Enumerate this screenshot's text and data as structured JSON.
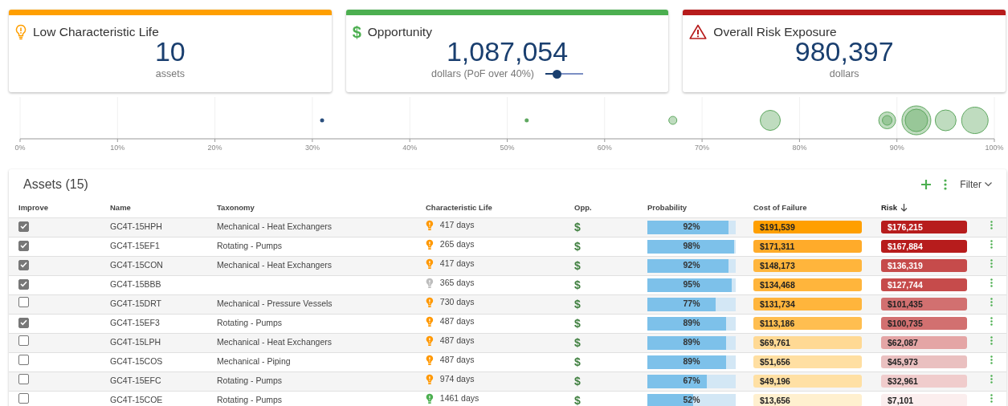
{
  "cards": [
    {
      "kind": "lightbulb",
      "color": "#ff9f00",
      "title": "Low Characteristic Life",
      "value": "10",
      "unit": "assets"
    },
    {
      "kind": "dollar",
      "color": "#4caf50",
      "icon": "$",
      "title": "Opportunity",
      "value": "1,087,054",
      "unit": "dollars (PoF over 40%)",
      "slider": {
        "level": 0.3
      }
    },
    {
      "kind": "warning",
      "color": "#b71c1c",
      "title": "Overall Risk Exposure",
      "value": "980,397",
      "unit": "dollars"
    }
  ],
  "bubble_chart": {
    "axis_labels": [
      "0%",
      "10%",
      "20%",
      "30%",
      "40%",
      "50%",
      "60%",
      "70%",
      "80%",
      "90%",
      "100%"
    ]
  },
  "assets": {
    "title": "Assets (15)",
    "filter": "Filter",
    "columns": [
      {
        "label": "Improve",
        "sorted": false
      },
      {
        "label": "Name",
        "sorted": false
      },
      {
        "label": "Taxonomy",
        "sorted": false
      },
      {
        "label": "Characteristic Life",
        "sorted": false
      },
      {
        "label": "Opp.",
        "sorted": false
      },
      {
        "label": "Probability",
        "sorted": false
      },
      {
        "label": "Cost of Failure",
        "sorted": false
      },
      {
        "label": "Risk",
        "sorted": true
      }
    ],
    "rows": [
      {
        "checked": true,
        "name": "GC4T-15HPH",
        "taxonomy": "Mechanical - Heat Exchangers",
        "life": {
          "text": "417 days",
          "color": "#ff9800"
        },
        "opp": "$",
        "probability": "92%",
        "level": 0.92,
        "cost": {
          "text": "$191,539",
          "color": "#ff9f00"
        },
        "risk": {
          "text": "$176,215",
          "color": "#b71c1c"
        }
      },
      {
        "checked": true,
        "name": "GC4T-15EF1",
        "taxonomy": "Rotating - Pumps",
        "life": {
          "text": "265 days",
          "color": "#ff9800"
        },
        "opp": "$",
        "probability": "98%",
        "level": 0.98,
        "cost": {
          "text": "$171,311",
          "color": "#ffab2a"
        },
        "risk": {
          "text": "$167,884",
          "color": "#b71c1c"
        }
      },
      {
        "checked": true,
        "name": "GC4T-15CON",
        "taxonomy": "Mechanical - Heat Exchangers",
        "life": {
          "text": "417 days",
          "color": "#ff9800"
        },
        "opp": "$",
        "probability": "92%",
        "level": 0.92,
        "cost": {
          "text": "$148,173",
          "color": "#ffb53c"
        },
        "risk": {
          "text": "$136,319",
          "color": "#c64b4b"
        }
      },
      {
        "checked": true,
        "name": "GC4T-15BBB",
        "life": {
          "text": "365 days",
          "color": "#bdbdbd"
        },
        "opp": "$",
        "probability": "95%",
        "level": 0.95,
        "cost": {
          "text": "$134,468",
          "color": "#ffb53c"
        },
        "risk": {
          "text": "$127,744",
          "color": "#c64b4b"
        }
      },
      {
        "checked": false,
        "name": "GC4T-15DRT",
        "taxonomy": "Mechanical - Pressure Vessels",
        "life": {
          "text": "730 days",
          "color": "#ff9800"
        },
        "opp": "$",
        "probability": "77%",
        "level": 0.77,
        "cost": {
          "text": "$131,734",
          "color": "#ffb53c"
        },
        "risk": {
          "text": "$101,435",
          "color": "#d27070"
        }
      },
      {
        "checked": true,
        "name": "GC4T-15EF3",
        "taxonomy": "Rotating - Pumps",
        "life": {
          "text": "487 days",
          "color": "#ff9800"
        },
        "opp": "$",
        "probability": "89%",
        "level": 0.89,
        "cost": {
          "text": "$113,186",
          "color": "#ffbe50"
        },
        "risk": {
          "text": "$100,735",
          "color": "#d27070"
        }
      },
      {
        "checked": false,
        "name": "GC4T-15LPH",
        "taxonomy": "Mechanical - Heat Exchangers",
        "life": {
          "text": "487 days",
          "color": "#ff9800"
        },
        "opp": "$",
        "probability": "89%",
        "level": 0.89,
        "cost": {
          "text": "$69,761",
          "color": "#ffd994"
        },
        "risk": {
          "text": "$62,087",
          "color": "#e4a5a5"
        }
      },
      {
        "checked": false,
        "name": "GC4T-15COS",
        "taxonomy": "Mechanical - Piping",
        "life": {
          "text": "487 days",
          "color": "#ff9800"
        },
        "opp": "$",
        "probability": "89%",
        "level": 0.89,
        "cost": {
          "text": "$51,656",
          "color": "#ffdfa2"
        },
        "risk": {
          "text": "$45,973",
          "color": "#eac0c0"
        }
      },
      {
        "checked": false,
        "name": "GC4T-15EFC",
        "taxonomy": "Rotating - Pumps",
        "life": {
          "text": "974 days",
          "color": "#ff9800"
        },
        "opp": "$",
        "probability": "67%",
        "level": 0.67,
        "cost": {
          "text": "$49,196",
          "color": "#ffe0a4"
        },
        "risk": {
          "text": "$32,961",
          "color": "#f0cccc"
        }
      },
      {
        "checked": false,
        "name": "GC4T-15COE",
        "taxonomy": "Rotating - Pumps",
        "life": {
          "text": "1461 days",
          "color": "#4caf50"
        },
        "opp": "$",
        "probability": "52%",
        "level": 0.52,
        "cost": {
          "text": "$13,656",
          "color": "#fff0cf"
        },
        "risk": {
          "text": "$7,101",
          "color": "#fbeeee"
        }
      }
    ]
  }
}
